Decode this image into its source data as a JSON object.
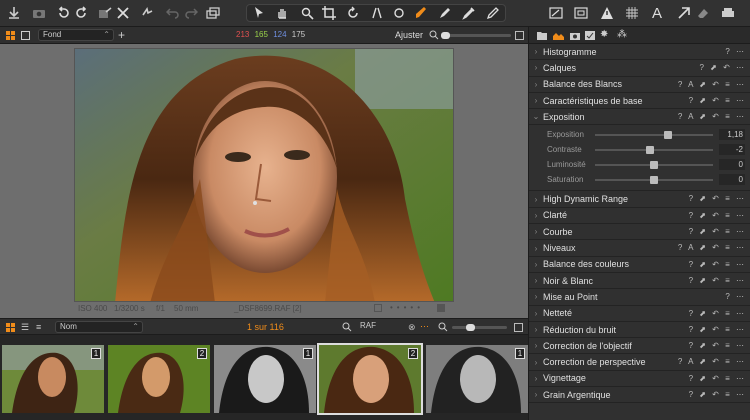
{
  "colors": {
    "accent": "#f08c1a",
    "red": "#e05050",
    "green": "#9bd34a",
    "blue": "#6f8fe0"
  },
  "subbar": {
    "preset": "Fond",
    "rgb": {
      "r": "213",
      "g": "165",
      "b": "124",
      "l": "175"
    },
    "zoom_label": "Ajuster"
  },
  "viewer": {
    "iso": "ISO 400",
    "shutter": "1/3200 s",
    "aperture": "f/1",
    "focal": "50 mm",
    "filename": "_DSF8699.RAF [2]"
  },
  "browser": {
    "sort": "Nom",
    "counter": "1 sur 116",
    "search": "RAF"
  },
  "thumbs": [
    {
      "badge": "1",
      "style": "color"
    },
    {
      "badge": "2",
      "style": "color"
    },
    {
      "badge": "1",
      "style": "bw"
    },
    {
      "badge": "2",
      "style": "color",
      "selected": true
    },
    {
      "badge": "1",
      "style": "bw"
    }
  ],
  "panel": {
    "sections_top": [
      {
        "label": "Histogramme",
        "icons": "? ⋯"
      },
      {
        "label": "Calques",
        "icons": "? ⬈ ↶ ⋯"
      },
      {
        "label": "Balance des Blancs",
        "icons": "? A ⬈ ↶ ≡ ⋯"
      },
      {
        "label": "Caractéristiques de base",
        "icons": "? ⬈ ↶ ≡ ⋯"
      }
    ],
    "exposition": {
      "label": "Exposition",
      "icons": "? A ⬈ ↶ ≡ ⋯",
      "sliders": [
        {
          "label": "Exposition",
          "value": "1,18",
          "pos": 0.62
        },
        {
          "label": "Contraste",
          "value": "-2",
          "pos": 0.47
        },
        {
          "label": "Luminosité",
          "value": "0",
          "pos": 0.5
        },
        {
          "label": "Saturation",
          "value": "0",
          "pos": 0.5
        }
      ]
    },
    "sections_bottom": [
      {
        "label": "High Dynamic Range",
        "icons": "? ⬈ ↶ ≡ ⋯"
      },
      {
        "label": "Clarté",
        "icons": "? ⬈ ↶ ≡ ⋯"
      },
      {
        "label": "Courbe",
        "icons": "? ⬈ ↶ ≡ ⋯"
      },
      {
        "label": "Niveaux",
        "icons": "? A ⬈ ↶ ≡ ⋯"
      },
      {
        "label": "Balance des couleurs",
        "icons": "? ⬈ ↶ ≡ ⋯"
      },
      {
        "label": "Noir & Blanc",
        "icons": "? ⬈ ↶ ≡ ⋯"
      },
      {
        "label": "Mise au Point",
        "icons": "? ⋯"
      },
      {
        "label": "Netteté",
        "icons": "? ⬈ ↶ ≡ ⋯"
      },
      {
        "label": "Réduction du bruit",
        "icons": "? ⬈ ↶ ≡ ⋯"
      },
      {
        "label": "Correction de l'objectif",
        "icons": "? ⬈ ↶ ≡ ⋯"
      },
      {
        "label": "Correction de perspective",
        "icons": "? A ⬈ ↶ ≡ ⋯"
      },
      {
        "label": "Vignettage",
        "icons": "? ⬈ ↶ ≡ ⋯"
      },
      {
        "label": "Grain Argentique",
        "icons": "? ⬈ ↶ ≡ ⋯"
      }
    ]
  }
}
